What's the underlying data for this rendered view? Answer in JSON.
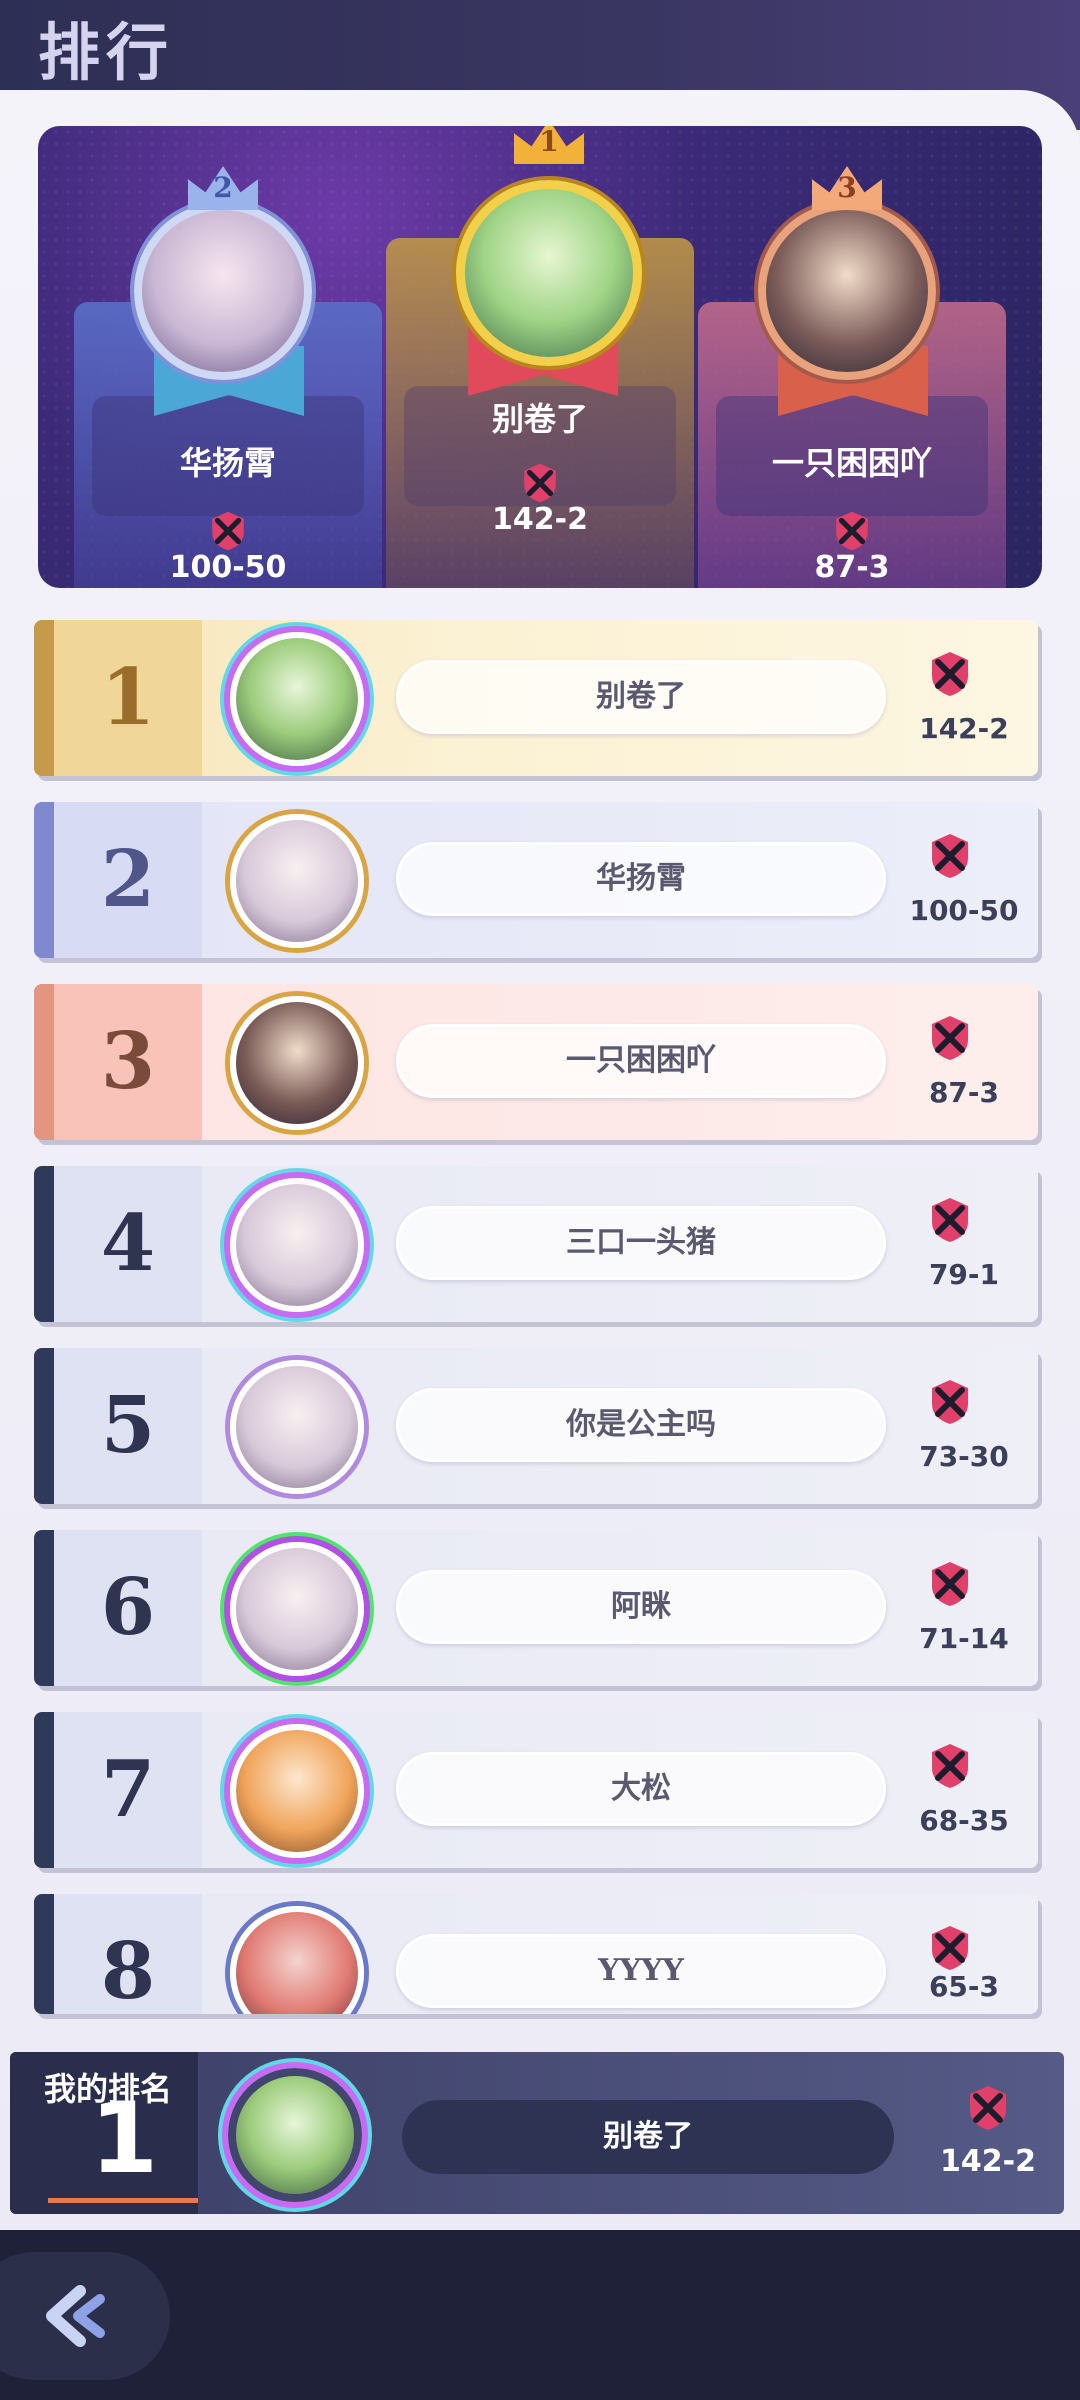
{
  "header": {
    "title": "排行"
  },
  "podium": [
    {
      "place": "2",
      "name": "华扬霄",
      "score": "100-50"
    },
    {
      "place": "1",
      "name": "别卷了",
      "score": "142-2"
    },
    {
      "place": "3",
      "name": "一只困困吖",
      "score": "87-3"
    }
  ],
  "rows": [
    {
      "rank": "1",
      "name": "别卷了",
      "score": "142-2"
    },
    {
      "rank": "2",
      "name": "华扬霄",
      "score": "100-50"
    },
    {
      "rank": "3",
      "name": "一只困困吖",
      "score": "87-3"
    },
    {
      "rank": "4",
      "name": "三口一头猪",
      "score": "79-1"
    },
    {
      "rank": "5",
      "name": "你是公主吗",
      "score": "73-30"
    },
    {
      "rank": "6",
      "name": "阿眯",
      "score": "71-14"
    },
    {
      "rank": "7",
      "name": "大松",
      "score": "68-35"
    },
    {
      "rank": "8",
      "name": "YYYY",
      "score": "65-3"
    }
  ],
  "my_rank": {
    "label": "我的排名",
    "rank": "1",
    "name": "别卷了",
    "score": "142-2"
  },
  "icons": {
    "score": "crossed-swords-icon",
    "back": "back-arrow-icon"
  },
  "colors": {
    "header_bg": "#2e2f55",
    "gold": "#f3d04a",
    "silver": "#7e89d0",
    "bronze": "#e49580",
    "score_icon": "#e0406a"
  }
}
